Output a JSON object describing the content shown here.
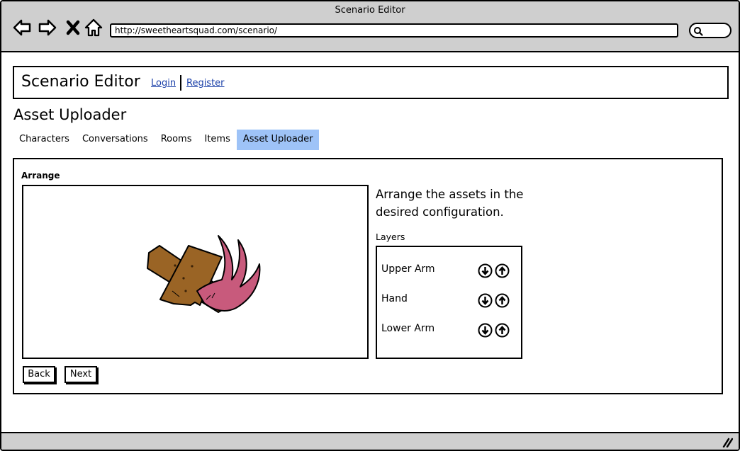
{
  "window": {
    "title": "Scenario Editor"
  },
  "browser": {
    "url": "http://sweetheartsquad.com/scenario/",
    "icons": [
      "back-arrow-icon",
      "forward-arrow-icon",
      "close-x-icon",
      "home-icon",
      "search-icon"
    ]
  },
  "header": {
    "title": "Scenario Editor",
    "login": "Login",
    "register": "Register"
  },
  "page": {
    "heading": "Asset Uploader"
  },
  "tabs": [
    {
      "label": "Characters",
      "active": false
    },
    {
      "label": "Conversations",
      "active": false
    },
    {
      "label": "Rooms",
      "active": false
    },
    {
      "label": "Items",
      "active": false
    },
    {
      "label": "Asset Uploader",
      "active": true
    }
  ],
  "arrange": {
    "label": "Arrange",
    "instructions": "Arrange the assets in the desired configuration.",
    "layers_label": "Layers",
    "layers": [
      {
        "name": "Upper Arm"
      },
      {
        "name": "Hand"
      },
      {
        "name": "Lower Arm"
      }
    ]
  },
  "buttons": {
    "back": "Back",
    "next": "Next"
  },
  "colors": {
    "chrome": "#cfcfcf",
    "active_tab": "#9ec3f7",
    "link": "#1a3fa8",
    "wood": "#9a6425",
    "claw": "#c85a7c"
  }
}
